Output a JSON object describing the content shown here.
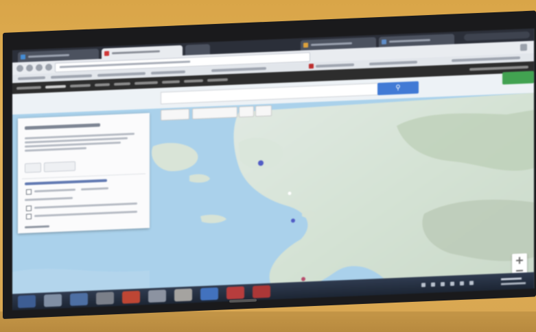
{
  "scene": {
    "wall_color": "#dcab52",
    "monitor_color": "#1a1a1c"
  },
  "browser": {
    "tabs": [
      {
        "icon": "google-drive-icon",
        "active": false
      },
      {
        "icon": "gmail-icon",
        "active": true
      },
      {
        "icon": "tab-icon",
        "active": false
      },
      {
        "icon": "tab-icon",
        "active": false
      },
      {
        "icon": "tab-icon",
        "active": false
      }
    ],
    "address_bar": {
      "value": ""
    },
    "accent_color": "#3b7be0"
  },
  "maps": {
    "search_button_icon": "search-icon",
    "share_button_color": "#3aa54b",
    "panel": {
      "layer_count": 2
    },
    "zoom_control_icons": [
      "zoom-in-icon",
      "zoom-out-icon"
    ]
  },
  "taskbar": {
    "items": [
      {
        "icon": "start-icon",
        "color": "#3a5d99"
      },
      {
        "icon": "folder-icon",
        "color": "#7e8fa6"
      },
      {
        "icon": "ie-icon",
        "color": "#4a6fa9"
      },
      {
        "icon": "app-icon",
        "color": "#7a7f8a"
      },
      {
        "icon": "chrome-icon",
        "color": "#c9432f"
      },
      {
        "icon": "app-icon",
        "color": "#8b93a3"
      },
      {
        "icon": "app-icon",
        "color": "#a5a3a0"
      },
      {
        "icon": "app-icon",
        "color": "#3d73c7"
      },
      {
        "icon": "app-icon",
        "color": "#c23a3a"
      },
      {
        "icon": "app-icon",
        "color": "#b53434"
      }
    ]
  }
}
